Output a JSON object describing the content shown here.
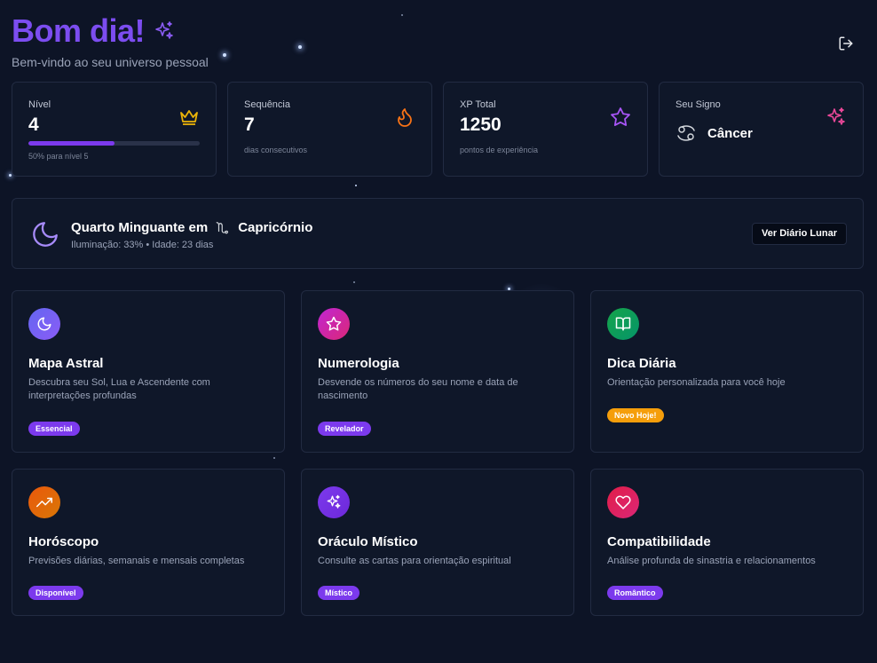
{
  "header": {
    "title": "Bom dia!",
    "subtitle": "Bem-vindo ao seu universo pessoal"
  },
  "stats": [
    {
      "label": "Nível",
      "value": "4",
      "sub": "50% para nível 5",
      "progress": 0.5,
      "icon": "crown-icon",
      "color": "#eab308"
    },
    {
      "label": "Sequência",
      "value": "7",
      "sub": "dias consecutivos",
      "icon": "flame-icon",
      "color": "#f97316"
    },
    {
      "label": "XP Total",
      "value": "1250",
      "sub": "pontos de experiência",
      "icon": "star-icon",
      "color": "#a855f7"
    },
    {
      "label": "Seu Signo",
      "value": "Câncer",
      "icon": "sparkles-icon",
      "color": "#ec4899"
    }
  ],
  "moon": {
    "title": "Quarto Minguante em",
    "sign": "Capricórnio",
    "details": "Iluminação: 33% • Idade: 23 dias",
    "button": "Ver Diário Lunar"
  },
  "features": [
    {
      "title": "Mapa Astral",
      "desc": "Descubra seu Sol, Lua e Ascendente com interpretações profundas",
      "badge": "Essencial",
      "icon": "moon-icon"
    },
    {
      "title": "Numerologia",
      "desc": "Desvende os números do seu nome e data de nascimento",
      "badge": "Revelador",
      "icon": "star-icon"
    },
    {
      "title": "Dica Diária",
      "desc": "Orientação personalizada para você hoje",
      "badge": "Novo Hoje!",
      "icon": "book-open-icon"
    },
    {
      "title": "Horóscopo",
      "desc": "Previsões diárias, semanais e mensais completas",
      "badge": "Disponível",
      "icon": "trending-up-icon"
    },
    {
      "title": "Oráculo Místico",
      "desc": "Consulte as cartas para orientação espiritual",
      "badge": "Místico",
      "icon": "sparkles-icon"
    },
    {
      "title": "Compatibilidade",
      "desc": "Análise profunda de sinastria e relacionamentos",
      "badge": "Romântico",
      "icon": "heart-icon"
    }
  ],
  "colors": {
    "accent": "#7c4df0",
    "background": "#0d1426",
    "card": "#0f1729",
    "badge_purple": "#7c3aed",
    "badge_orange": "#f59e0b"
  }
}
